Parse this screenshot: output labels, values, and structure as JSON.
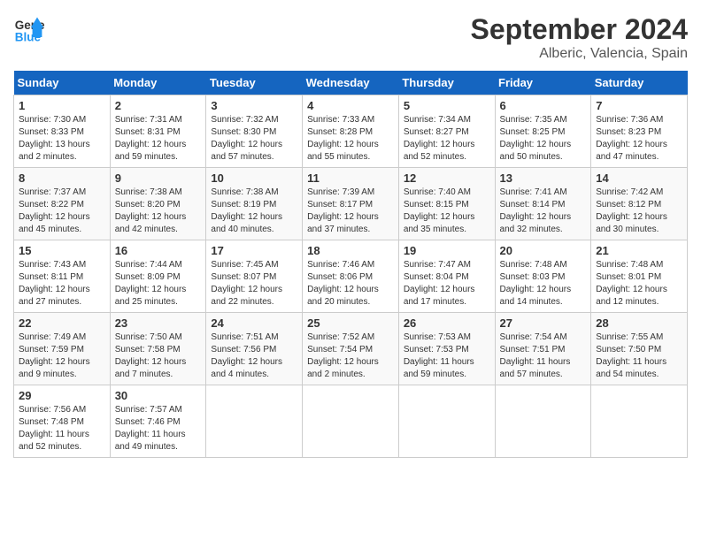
{
  "header": {
    "logo_line1": "General",
    "logo_line2": "Blue",
    "month": "September 2024",
    "location": "Alberic, Valencia, Spain"
  },
  "weekdays": [
    "Sunday",
    "Monday",
    "Tuesday",
    "Wednesday",
    "Thursday",
    "Friday",
    "Saturday"
  ],
  "weeks": [
    [
      {
        "day": "1",
        "sunrise": "Sunrise: 7:30 AM",
        "sunset": "Sunset: 8:33 PM",
        "daylight": "Daylight: 13 hours and 2 minutes."
      },
      {
        "day": "2",
        "sunrise": "Sunrise: 7:31 AM",
        "sunset": "Sunset: 8:31 PM",
        "daylight": "Daylight: 12 hours and 59 minutes."
      },
      {
        "day": "3",
        "sunrise": "Sunrise: 7:32 AM",
        "sunset": "Sunset: 8:30 PM",
        "daylight": "Daylight: 12 hours and 57 minutes."
      },
      {
        "day": "4",
        "sunrise": "Sunrise: 7:33 AM",
        "sunset": "Sunset: 8:28 PM",
        "daylight": "Daylight: 12 hours and 55 minutes."
      },
      {
        "day": "5",
        "sunrise": "Sunrise: 7:34 AM",
        "sunset": "Sunset: 8:27 PM",
        "daylight": "Daylight: 12 hours and 52 minutes."
      },
      {
        "day": "6",
        "sunrise": "Sunrise: 7:35 AM",
        "sunset": "Sunset: 8:25 PM",
        "daylight": "Daylight: 12 hours and 50 minutes."
      },
      {
        "day": "7",
        "sunrise": "Sunrise: 7:36 AM",
        "sunset": "Sunset: 8:23 PM",
        "daylight": "Daylight: 12 hours and 47 minutes."
      }
    ],
    [
      {
        "day": "8",
        "sunrise": "Sunrise: 7:37 AM",
        "sunset": "Sunset: 8:22 PM",
        "daylight": "Daylight: 12 hours and 45 minutes."
      },
      {
        "day": "9",
        "sunrise": "Sunrise: 7:38 AM",
        "sunset": "Sunset: 8:20 PM",
        "daylight": "Daylight: 12 hours and 42 minutes."
      },
      {
        "day": "10",
        "sunrise": "Sunrise: 7:38 AM",
        "sunset": "Sunset: 8:19 PM",
        "daylight": "Daylight: 12 hours and 40 minutes."
      },
      {
        "day": "11",
        "sunrise": "Sunrise: 7:39 AM",
        "sunset": "Sunset: 8:17 PM",
        "daylight": "Daylight: 12 hours and 37 minutes."
      },
      {
        "day": "12",
        "sunrise": "Sunrise: 7:40 AM",
        "sunset": "Sunset: 8:15 PM",
        "daylight": "Daylight: 12 hours and 35 minutes."
      },
      {
        "day": "13",
        "sunrise": "Sunrise: 7:41 AM",
        "sunset": "Sunset: 8:14 PM",
        "daylight": "Daylight: 12 hours and 32 minutes."
      },
      {
        "day": "14",
        "sunrise": "Sunrise: 7:42 AM",
        "sunset": "Sunset: 8:12 PM",
        "daylight": "Daylight: 12 hours and 30 minutes."
      }
    ],
    [
      {
        "day": "15",
        "sunrise": "Sunrise: 7:43 AM",
        "sunset": "Sunset: 8:11 PM",
        "daylight": "Daylight: 12 hours and 27 minutes."
      },
      {
        "day": "16",
        "sunrise": "Sunrise: 7:44 AM",
        "sunset": "Sunset: 8:09 PM",
        "daylight": "Daylight: 12 hours and 25 minutes."
      },
      {
        "day": "17",
        "sunrise": "Sunrise: 7:45 AM",
        "sunset": "Sunset: 8:07 PM",
        "daylight": "Daylight: 12 hours and 22 minutes."
      },
      {
        "day": "18",
        "sunrise": "Sunrise: 7:46 AM",
        "sunset": "Sunset: 8:06 PM",
        "daylight": "Daylight: 12 hours and 20 minutes."
      },
      {
        "day": "19",
        "sunrise": "Sunrise: 7:47 AM",
        "sunset": "Sunset: 8:04 PM",
        "daylight": "Daylight: 12 hours and 17 minutes."
      },
      {
        "day": "20",
        "sunrise": "Sunrise: 7:48 AM",
        "sunset": "Sunset: 8:03 PM",
        "daylight": "Daylight: 12 hours and 14 minutes."
      },
      {
        "day": "21",
        "sunrise": "Sunrise: 7:48 AM",
        "sunset": "Sunset: 8:01 PM",
        "daylight": "Daylight: 12 hours and 12 minutes."
      }
    ],
    [
      {
        "day": "22",
        "sunrise": "Sunrise: 7:49 AM",
        "sunset": "Sunset: 7:59 PM",
        "daylight": "Daylight: 12 hours and 9 minutes."
      },
      {
        "day": "23",
        "sunrise": "Sunrise: 7:50 AM",
        "sunset": "Sunset: 7:58 PM",
        "daylight": "Daylight: 12 hours and 7 minutes."
      },
      {
        "day": "24",
        "sunrise": "Sunrise: 7:51 AM",
        "sunset": "Sunset: 7:56 PM",
        "daylight": "Daylight: 12 hours and 4 minutes."
      },
      {
        "day": "25",
        "sunrise": "Sunrise: 7:52 AM",
        "sunset": "Sunset: 7:54 PM",
        "daylight": "Daylight: 12 hours and 2 minutes."
      },
      {
        "day": "26",
        "sunrise": "Sunrise: 7:53 AM",
        "sunset": "Sunset: 7:53 PM",
        "daylight": "Daylight: 11 hours and 59 minutes."
      },
      {
        "day": "27",
        "sunrise": "Sunrise: 7:54 AM",
        "sunset": "Sunset: 7:51 PM",
        "daylight": "Daylight: 11 hours and 57 minutes."
      },
      {
        "day": "28",
        "sunrise": "Sunrise: 7:55 AM",
        "sunset": "Sunset: 7:50 PM",
        "daylight": "Daylight: 11 hours and 54 minutes."
      }
    ],
    [
      {
        "day": "29",
        "sunrise": "Sunrise: 7:56 AM",
        "sunset": "Sunset: 7:48 PM",
        "daylight": "Daylight: 11 hours and 52 minutes."
      },
      {
        "day": "30",
        "sunrise": "Sunrise: 7:57 AM",
        "sunset": "Sunset: 7:46 PM",
        "daylight": "Daylight: 11 hours and 49 minutes."
      },
      null,
      null,
      null,
      null,
      null
    ]
  ]
}
